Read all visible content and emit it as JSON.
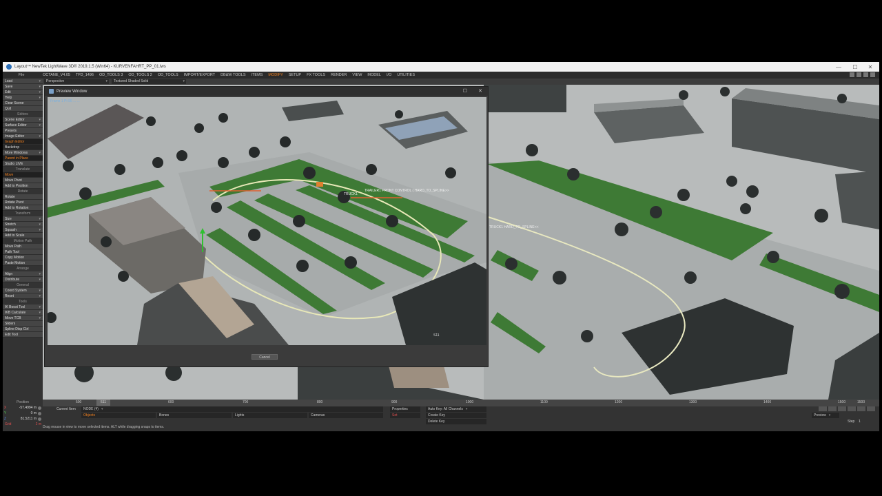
{
  "window": {
    "title": "Layout™ NewTek LightWave 3D® 2019.1.5 (Win64) - KURVENFAHRT_PP_01.lws",
    "controls": [
      "—",
      "☐",
      "✕"
    ]
  },
  "tabs": [
    "File",
    "OCTANE_V4.05",
    "TFD_1496",
    "OD_TOOLS 3",
    "OD_TOOLS 2",
    "OD_TOOLS",
    "IMPORT/EXPORT",
    "DB&W TOOLS",
    "ITEMS",
    "MODIFY",
    "SETUP",
    "FX TOOLS",
    "RENDER",
    "VIEW",
    "MODEL",
    "I/O",
    "UTILITIES"
  ],
  "active_tab": "MODIFY",
  "left_panel": {
    "file_items": [
      "Load",
      "Save",
      "Edit",
      "Help",
      "Clear Scene",
      "Quit"
    ],
    "editors_head": "Editors",
    "editors": [
      "Scene Editor",
      "Surface Editor",
      "Presets",
      "Image Editor",
      "Graph Editor",
      "Backdrop",
      "More Windows",
      "Parent in Place",
      "Studio LIVE"
    ],
    "translate_head": "Translate",
    "translate": [
      "Move",
      "Move Pivot",
      "Add to Position"
    ],
    "rotate_head": "Rotate",
    "rotate": [
      "Rotate",
      "Rotate Pivot",
      "Add to Rotation"
    ],
    "transform_head": "Transform",
    "transform": [
      "Size",
      "Stretch",
      "Squash",
      "Add to Scale"
    ],
    "motion_head": "Motion Path",
    "motion": [
      "Move Path",
      "Path Tool",
      "Copy Motion",
      "Paste Motion"
    ],
    "arrange_head": "Arrange",
    "arrange": [
      "Align",
      "Distribute"
    ],
    "general_head": "General",
    "general": [
      "Coord System",
      "Reset"
    ],
    "tools_head": "Tools",
    "tools": [
      "IK Boost Tool",
      "IKB Calculate",
      "Move TCB",
      "Sliders",
      "Spline Disp Ctrl",
      "Edit Tool"
    ]
  },
  "viewport": {
    "view_mode": "Perspective",
    "shading": "Textured Shaded Solid"
  },
  "preview_window": {
    "title": "Preview Window",
    "stats": "Frame 1   Pt 56 ...   ...",
    "cancel_label": "Cancel",
    "overlay_label_1": "TRAILER1 FRONT CONTROL ( HARD_TO_SPLINE>>",
    "overlay_label_2": "TRUCK1",
    "right_label": "TRUCK1 HARD_TO_SPLINE<<",
    "building_tag": "S11"
  },
  "timeline": {
    "ticks": [
      "500",
      "600",
      "700",
      "800",
      "900",
      "1000",
      "1100",
      "1200",
      "1300",
      "1400",
      "1500",
      "1500"
    ],
    "current_frame": "511"
  },
  "position": {
    "label": "Position",
    "x": "-57.4994 m",
    "y": "0 m",
    "z": "81.5211 m",
    "grid_label": "Grid",
    "grid_value": "2 m"
  },
  "controls": {
    "current_item_label": "Current Item",
    "current_item_value": "NODE (4)",
    "objects_label": "Objects",
    "bones_label": "Bones",
    "lights_label": "Lights",
    "cameras_label": "Cameras",
    "properties_label": "Properties",
    "set_label": "Set",
    "auto_key_label": "Auto Key: All Channels",
    "create_key_label": "Create Key",
    "delete_key_label": "Delete Key",
    "preview_label": "Preview",
    "step_label": "Step",
    "step_value": "1",
    "status_text": "Drag mouse in view to move selected items. ALT while dragging snaps to items."
  }
}
